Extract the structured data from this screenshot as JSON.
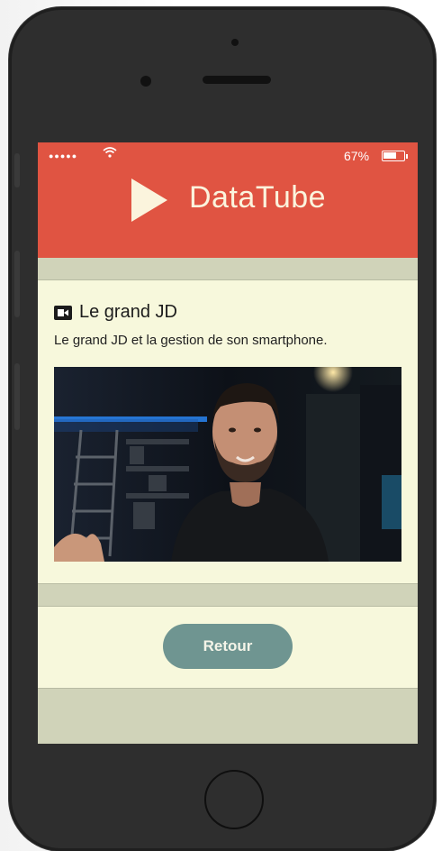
{
  "status_bar": {
    "signal_icon": "signal-dots-icon",
    "wifi_icon": "wifi-icon",
    "battery_percent": "67%",
    "battery_level": 0.67
  },
  "header": {
    "logo_icon": "play-triangle-icon",
    "title": "DataTube",
    "background_color": "#e05442"
  },
  "video": {
    "type_icon": "video-camera-icon",
    "title": "Le grand JD",
    "description": "Le grand JD et la gestion de son smartphone."
  },
  "actions": {
    "back_label": "Retour",
    "back_color": "#6f9591"
  },
  "colors": {
    "panel": "#f7f8dc",
    "page": "#d0d3b9",
    "phone": "#2e2e2e"
  }
}
